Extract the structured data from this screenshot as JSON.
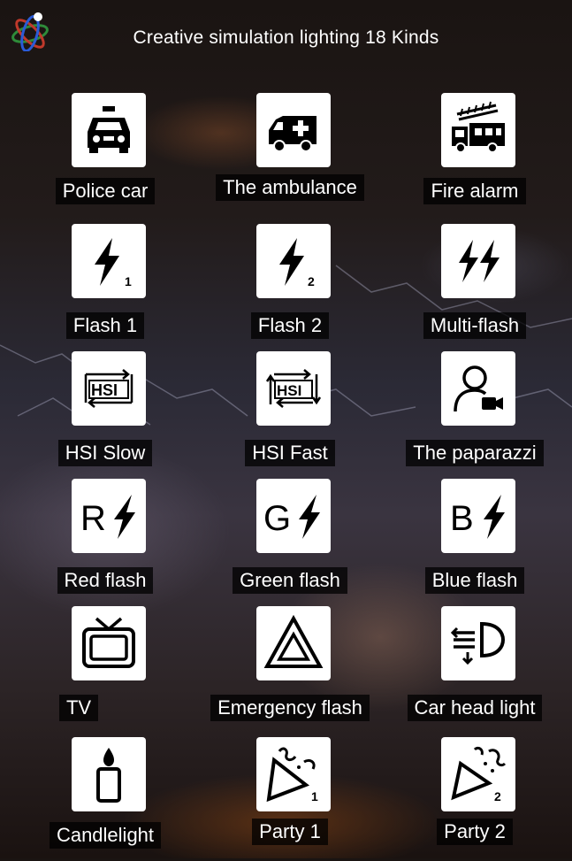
{
  "header": {
    "title": "Creative simulation lighting 18 Kinds",
    "logo_icon": "atom-icon"
  },
  "modes": [
    {
      "label": "Police car",
      "icon": "police-car-icon"
    },
    {
      "label": "The ambulance",
      "icon": "ambulance-icon"
    },
    {
      "label": "Fire alarm",
      "icon": "fire-truck-icon"
    },
    {
      "label": "Flash 1",
      "icon": "flash-1-icon",
      "badge": "1"
    },
    {
      "label": "Flash 2",
      "icon": "flash-2-icon",
      "badge": "2"
    },
    {
      "label": "Multi-flash",
      "icon": "multi-flash-icon"
    },
    {
      "label": "HSI Slow",
      "icon": "hsi-slow-icon",
      "text": "HSI"
    },
    {
      "label": "HSI Fast",
      "icon": "hsi-fast-icon",
      "text": "HSI"
    },
    {
      "label": "The paparazzi",
      "icon": "paparazzi-icon"
    },
    {
      "label": "Red flash",
      "icon": "red-flash-icon",
      "letter": "R"
    },
    {
      "label": "Green flash",
      "icon": "green-flash-icon",
      "letter": "G"
    },
    {
      "label": "Blue flash",
      "icon": "blue-flash-icon",
      "letter": "B"
    },
    {
      "label": "TV",
      "icon": "tv-icon"
    },
    {
      "label": "Emergency flash",
      "icon": "warning-triangle-icon"
    },
    {
      "label": "Car head light",
      "icon": "headlight-icon"
    },
    {
      "label": "Candlelight",
      "icon": "candle-icon"
    },
    {
      "label": "Party 1",
      "icon": "party-popper-1-icon",
      "badge": "1"
    },
    {
      "label": "Party 2",
      "icon": "party-popper-2-icon",
      "badge": "2"
    }
  ]
}
